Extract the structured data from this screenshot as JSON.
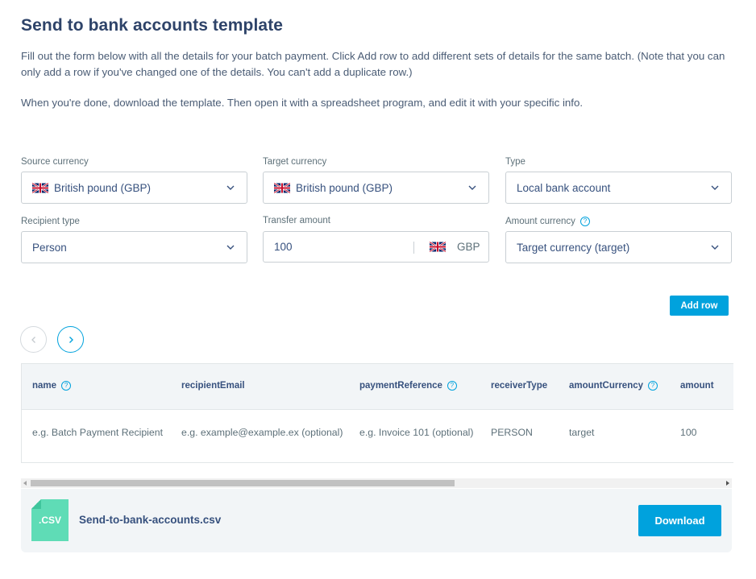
{
  "page": {
    "title": "Send to bank accounts template",
    "intro_1": "Fill out the form below with all the details for your batch payment. Click Add row to add different sets of details for the same batch. (Note that you can only add a row if you've changed one of the details. You can't add a duplicate row.)",
    "intro_2": "When you're done, download the template. Then open it with a spreadsheet program, and edit it with your specific info."
  },
  "form": {
    "source_currency": {
      "label": "Source currency",
      "value": "British pound (GBP)",
      "flag": "uk-flag-icon"
    },
    "target_currency": {
      "label": "Target currency",
      "value": "British pound (GBP)",
      "flag": "uk-flag-icon"
    },
    "type": {
      "label": "Type",
      "value": "Local bank account"
    },
    "recipient_type": {
      "label": "Recipient type",
      "value": "Person"
    },
    "transfer_amount": {
      "label": "Transfer amount",
      "value": "100",
      "currency": "GBP"
    },
    "amount_currency": {
      "label": "Amount currency",
      "value": "Target currency (target)"
    },
    "add_row_label": "Add row"
  },
  "table": {
    "columns": [
      "name",
      "recipientEmail",
      "paymentReference",
      "receiverType",
      "amountCurrency",
      "amount"
    ],
    "row": [
      "e.g. Batch Payment Recipient",
      "e.g. example@example.ex (optional)",
      "e.g. Invoice 101 (optional)",
      "PERSON",
      "target",
      "100"
    ]
  },
  "file": {
    "icon_label": ".CSV",
    "name": "Send-to-bank-accounts.csv",
    "download_label": "Download"
  },
  "colors": {
    "accent": "#00a2dd",
    "heading": "#2e4369",
    "csv_icon": "#5fdcb6"
  }
}
